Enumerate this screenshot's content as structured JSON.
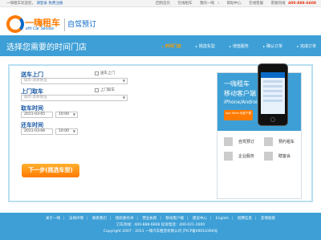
{
  "topbar": {
    "greeting": "一嗨租车欢迎您，",
    "login": "请登录",
    "register": "免费注册",
    "links": [
      "回到首页",
      "在线租车",
      "我的一嗨",
      "帮助中心",
      "在线客服"
    ],
    "hotline_label": "客服热线",
    "hotline_number": "400-888-6608",
    "colors": {
      "hotline": "#e8320e",
      "link": "#1a64b4"
    }
  },
  "header": {
    "logo_cn": "一嗨租车",
    "logo_en": "eHi Car Service",
    "subtitle": "自驾预订",
    "colors": {
      "brand_orange": "#ff7a00",
      "brand_blue": "#0a69c7"
    }
  },
  "banner": {
    "title": "选择您需要的时间门店",
    "steps": [
      "时间门店",
      "挑选车型",
      "增值服务",
      "确认订单",
      "完成订单"
    ],
    "active_step": 0,
    "colors": {
      "background": "#3d9fd6",
      "active": "#ff9d00"
    }
  },
  "form": {
    "pickup_title": "送车上门",
    "pickup_checkbox": "送车上门",
    "pickup_placeholder": "城市-具体地址",
    "return_title": "上门取车",
    "return_checkbox": "上门取车",
    "return_placeholder": "城市-具体地址",
    "pickup_time_title": "取车时间",
    "pickup_date": "2011-03-05",
    "pickup_hour": "10:00",
    "return_time_title": "还车时间",
    "return_date": "2011-03-06",
    "return_hour": "10:00",
    "submit_label": "下一步(挑选车型)"
  },
  "promo": {
    "line1": "一嗨租车",
    "line2": "移动客户端",
    "line3": "iPhone/Android",
    "appstore_text": "App Store 免费下载",
    "items": [
      "自驾预订",
      "预约租车",
      "企业服务",
      "瞎客会"
    ]
  },
  "footer": {
    "links": [
      "关于一嗨",
      "法律声明",
      "联系我们",
      "授权委托书",
      "营业执照",
      "移动客户端",
      "建议中心",
      "English",
      "招聘信息",
      "友情链接"
    ],
    "line2": "订车热线：400-888-6608    投诉电话：400-021-1600",
    "line3": "Copyright 2007 - 2011 一嗨汽车租赁有限公司    沪ICP备09010394号"
  }
}
